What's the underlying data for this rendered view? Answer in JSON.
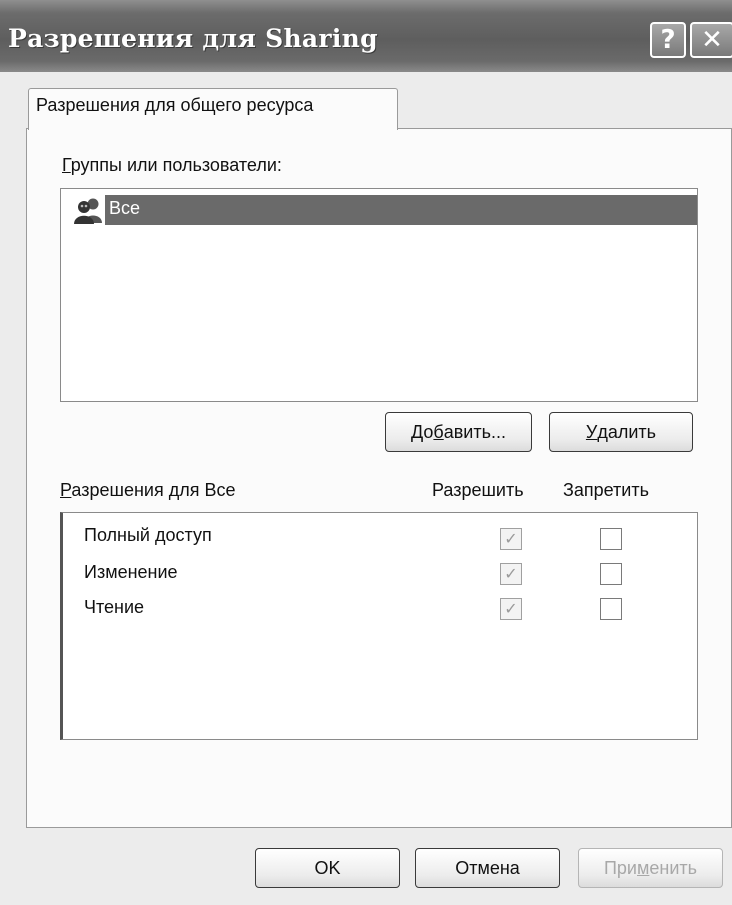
{
  "window": {
    "title": "Разрешения для Sharing",
    "help_glyph": "?",
    "close_glyph": "✕"
  },
  "tab": {
    "label": "Разрешения для общего ресурса"
  },
  "groups": {
    "label_access_key": "Г",
    "label_rest": "руппы или пользователи:",
    "items": [
      {
        "name": "Все",
        "icon": "user-group-icon",
        "selected": true
      }
    ]
  },
  "group_buttons": {
    "add_pre": "До",
    "add_key": "б",
    "add_post": "авить...",
    "remove_key": "У",
    "remove_post": "далить"
  },
  "permissions": {
    "label_access_key": "Р",
    "label_rest": "азрешения для Все",
    "allow_header": "Разрешить",
    "deny_header": "Запретить",
    "rows": [
      {
        "name": "Полный доступ",
        "allow": true,
        "deny": false
      },
      {
        "name": "Изменение",
        "allow": true,
        "deny": false
      },
      {
        "name": "Чтение",
        "allow": true,
        "deny": false
      }
    ],
    "check_glyph": "✓"
  },
  "footer": {
    "ok": "OK",
    "cancel": "Отмена",
    "apply_pre": "При",
    "apply_key": "м",
    "apply_post": "енить",
    "apply_enabled": false
  }
}
